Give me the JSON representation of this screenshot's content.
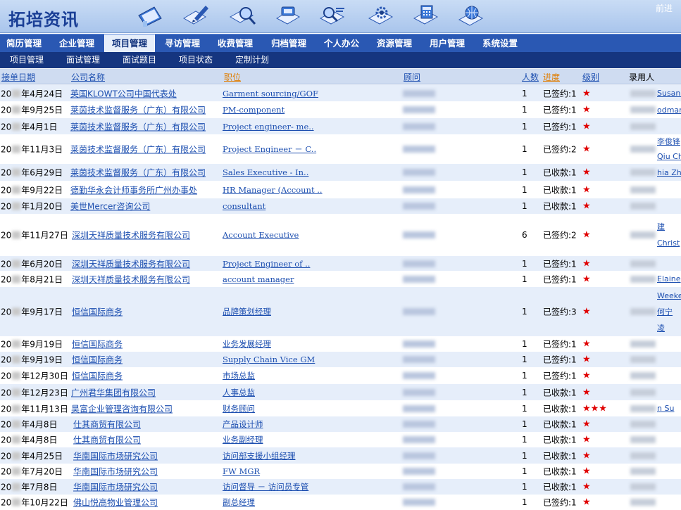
{
  "app": {
    "logo": "拓培资讯",
    "forward": "前进"
  },
  "toolbar_icons": [
    "notebook-icon",
    "edit-pencil-icon",
    "search-magnify-icon",
    "computer-document-icon",
    "search-list-icon",
    "tools-gear-icon",
    "calculator-icon",
    "globe-user-icon"
  ],
  "main_nav": [
    "简历管理",
    "企业管理",
    "项目管理",
    "寻访管理",
    "收费管理",
    "归档管理",
    "个人办公",
    "资源管理",
    "用户管理",
    "系统设置"
  ],
  "main_nav_active": "项目管理",
  "sub_nav": [
    "项目管理",
    "面试管理",
    "面试题目",
    "项目状态",
    "定制计划"
  ],
  "columns": {
    "date": "接单日期",
    "company": "公司名称",
    "position": "职位",
    "advisor": "顾问",
    "count": "人数",
    "progress": "进度",
    "level": "级别",
    "recruit": "录用人"
  },
  "colors": {
    "accent": "#2a58b3",
    "link": "#1d4fb0",
    "star": "#e00000",
    "header_sort": "#e07d00",
    "row_alt": "#e6eefa"
  },
  "rows": [
    {
      "date_pre": "20",
      "date_post": "年4月24日",
      "company": "英国KLOWT公司中国代表处",
      "position": "Garment sourcing/GOF",
      "count": "1",
      "status": "已签约:1",
      "stars": "★",
      "names": [
        "Susanna"
      ]
    },
    {
      "date_pre": "20",
      "date_post": "年9月25日",
      "company": "莱茵技术监督服务（广东）有限公司",
      "position": "PM-component",
      "count": "1",
      "status": "已签约:1",
      "stars": "★",
      "names": [
        "odman"
      ]
    },
    {
      "date_pre": "20",
      "date_post": "年4月1日",
      "company": "莱茵技术监督服务（广东）有限公司",
      "position": "Project engineer- me..",
      "count": "1",
      "status": "已签约:1",
      "stars": "★",
      "names": []
    },
    {
      "date_pre": "20",
      "date_post": "年11月3日",
      "company": "莱茵技术监督服务（广东）有限公司",
      "position": "Project Engineer － C..",
      "count": "1",
      "status": "已签约:2",
      "stars": "★",
      "names": [
        "李俊锋",
        "Qiu Ch"
      ]
    },
    {
      "date_pre": "20",
      "date_post": "年6月29日",
      "company": "莱茵技术监督服务（广东）有限公司",
      "position": "Sales Executive - In..",
      "count": "1",
      "status": "已收款:1",
      "stars": "★",
      "names": [
        "hia Zh"
      ]
    },
    {
      "date_pre": "20",
      "date_post": "年9月22日",
      "company": "德勤华永会计师事务所广州办事处",
      "position": "HR Manager (Account ..",
      "count": "1",
      "status": "已收款:1",
      "stars": "★",
      "names": []
    },
    {
      "date_pre": "20",
      "date_post": "年1月20日",
      "company": "美世Mercer咨询公司",
      "position": "consultant",
      "count": "1",
      "status": "已收款:1",
      "stars": "★",
      "names": []
    },
    {
      "date_pre": "20",
      "date_post": "年11月27日",
      "company": "深圳天祥质量技术服务有限公司",
      "position": "Account Executive",
      "count": "6",
      "status": "已签约:2",
      "stars": "★",
      "names": [
        "建",
        "Christ"
      ]
    },
    {
      "date_pre": "20",
      "date_post": "年6月20日",
      "company": "深圳天祥质量技术服务有限公司",
      "position": "Project Engineer of ..",
      "count": "1",
      "status": "已签约:1",
      "stars": "★",
      "names": []
    },
    {
      "date_pre": "20",
      "date_post": "年8月21日",
      "company": "深圳天祥质量技术服务有限公司",
      "position": "account manager",
      "count": "1",
      "status": "已签约:1",
      "stars": "★",
      "names": [
        "Elaine"
      ]
    },
    {
      "date_pre": "20",
      "date_post": "年9月17日",
      "company": "恒信国际商务",
      "position": "品牌策划经理",
      "count": "1",
      "status": "已签约:3",
      "stars": "★",
      "names": [
        "Weeke",
        "何宁",
        "凌"
      ]
    },
    {
      "date_pre": "20",
      "date_post": "年9月19日",
      "company": "恒信国际商务",
      "position": "业务发展经理",
      "count": "1",
      "status": "已签约:1",
      "stars": "★",
      "names": []
    },
    {
      "date_pre": "20",
      "date_post": "年9月19日",
      "company": "恒信国际商务",
      "position": "Supply Chain Vice GM",
      "count": "1",
      "status": "已签约:1",
      "stars": "★",
      "names": []
    },
    {
      "date_pre": "20",
      "date_post": "年12月30日",
      "company": "恒信国际商务",
      "position": "市场总监",
      "count": "1",
      "status": "已签约:1",
      "stars": "★",
      "names": []
    },
    {
      "date_pre": "20",
      "date_post": "年12月23日",
      "company": "广州君华集团有限公司",
      "position": "人事总监",
      "count": "1",
      "status": "已收款:1",
      "stars": "★",
      "names": []
    },
    {
      "date_pre": "20",
      "date_post": "年11月13日",
      "company": "昊富企业管理咨询有限公司",
      "position": "财务顾问",
      "count": "1",
      "status": "已收款:1",
      "stars": "★★★",
      "names": [
        "n Su"
      ]
    },
    {
      "date_pre": "20",
      "date_post": "年4月8日",
      "company": "仕其商贸有限公司",
      "position": "产品设计师",
      "count": "1",
      "status": "已收款:1",
      "stars": "★",
      "names": []
    },
    {
      "date_pre": "20",
      "date_post": "年4月8日",
      "company": "仕其商贸有限公司",
      "position": "业务副经理",
      "count": "1",
      "status": "已收款:1",
      "stars": "★",
      "names": []
    },
    {
      "date_pre": "20",
      "date_post": "年4月25日",
      "company": "华南国际市场研究公司",
      "position": "访问部支援小组经理",
      "count": "1",
      "status": "已收款:1",
      "stars": "★",
      "names": []
    },
    {
      "date_pre": "20",
      "date_post": "年7月20日",
      "company": "华南国际市场研究公司",
      "position": "FW MGR",
      "count": "1",
      "status": "已收款:1",
      "stars": "★",
      "names": []
    },
    {
      "date_pre": "20",
      "date_post": "年7月8日",
      "company": "华南国际市场研究公司",
      "position": "访问督导 － 访问员专管",
      "count": "1",
      "status": "已收款:1",
      "stars": "★",
      "names": []
    },
    {
      "date_pre": "20",
      "date_post": "年10月22日",
      "company": "佛山悦高物业管理公司",
      "position": "副总经理",
      "count": "1",
      "status": "已签约:1",
      "stars": "★",
      "names": []
    }
  ]
}
